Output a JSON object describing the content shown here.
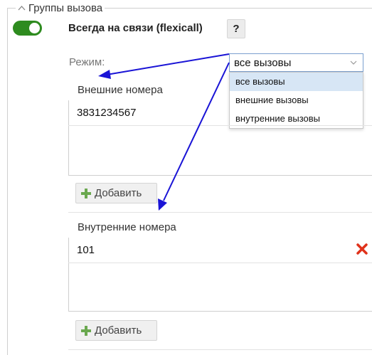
{
  "section": {
    "legend": "Группы вызова",
    "legend_icon": "chevron-up-icon"
  },
  "feature": {
    "enabled": true,
    "title": "Всегда на связи (flexicall)",
    "help_label": "?"
  },
  "mode": {
    "label": "Режим:",
    "selected": "все вызовы",
    "options": [
      "все вызовы",
      "внешние вызовы",
      "внутренние вызовы"
    ]
  },
  "external": {
    "header": "Внешние номера",
    "numbers": [
      "3831234567"
    ],
    "add_label": "Добавить"
  },
  "internal": {
    "header": "Внутренние номера",
    "numbers": [
      "101"
    ],
    "add_label": "Добавить"
  },
  "colors": {
    "toggle_on": "#2e8b1f",
    "delete": "#e0321b",
    "add_plus": "#6aa84f",
    "annotation_arrow": "#1a14d6",
    "dropdown_selected": "#d7e6f5"
  }
}
